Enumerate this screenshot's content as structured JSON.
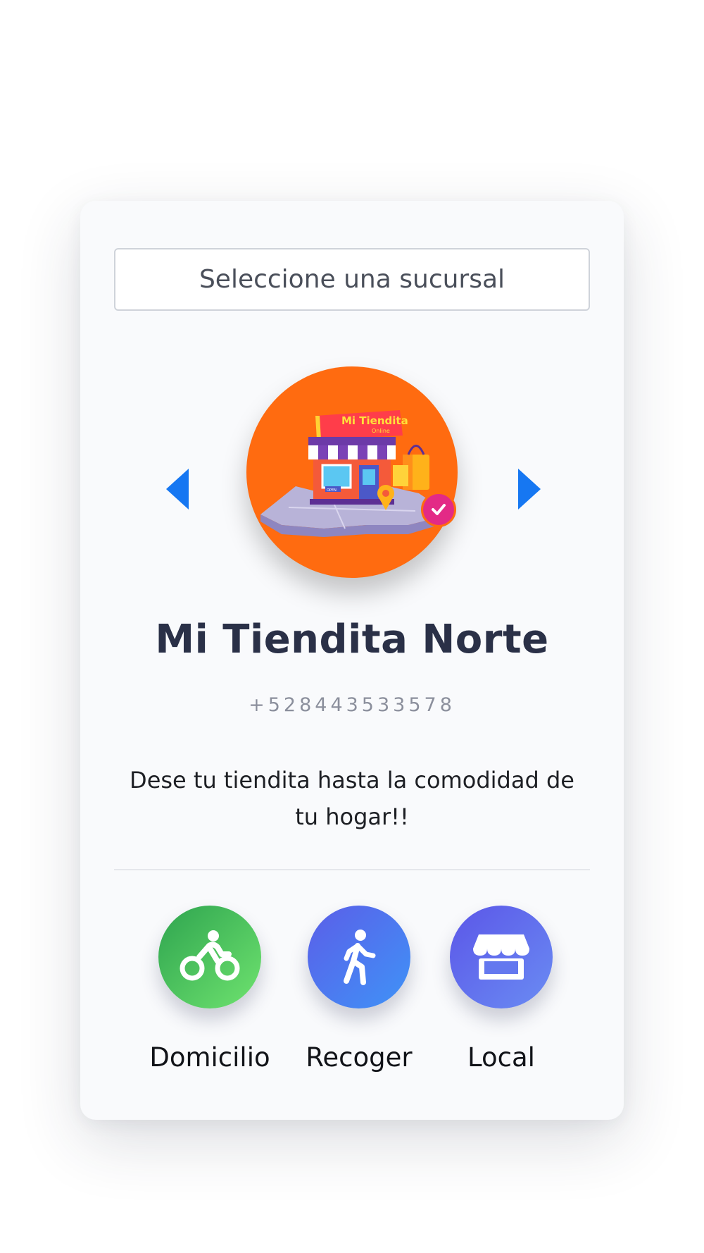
{
  "branch_select": {
    "placeholder": "Seleccione una sucursal"
  },
  "store": {
    "name": "Mi Tiendita Norte",
    "phone": "+528443533578",
    "description": "Dese tu tiendita hasta la comodidad de tu hogar!!",
    "logo": {
      "sign_text": "Mi Tiendita",
      "sign_subtext": "Online",
      "door_sign": "OPEN",
      "background_color": "#ff6b10",
      "verified_color": "#e32a86"
    }
  },
  "delivery_options": [
    {
      "label": "Domicilio",
      "icon": "bicycle-icon",
      "color": "#2ea44f"
    },
    {
      "label": "Recoger",
      "icon": "walking-person-icon",
      "color": "#3f93f7"
    },
    {
      "label": "Local",
      "icon": "storefront-icon",
      "color": "#5b56e8"
    }
  ],
  "colors": {
    "arrow": "#1677f2",
    "title": "#2a3047"
  }
}
